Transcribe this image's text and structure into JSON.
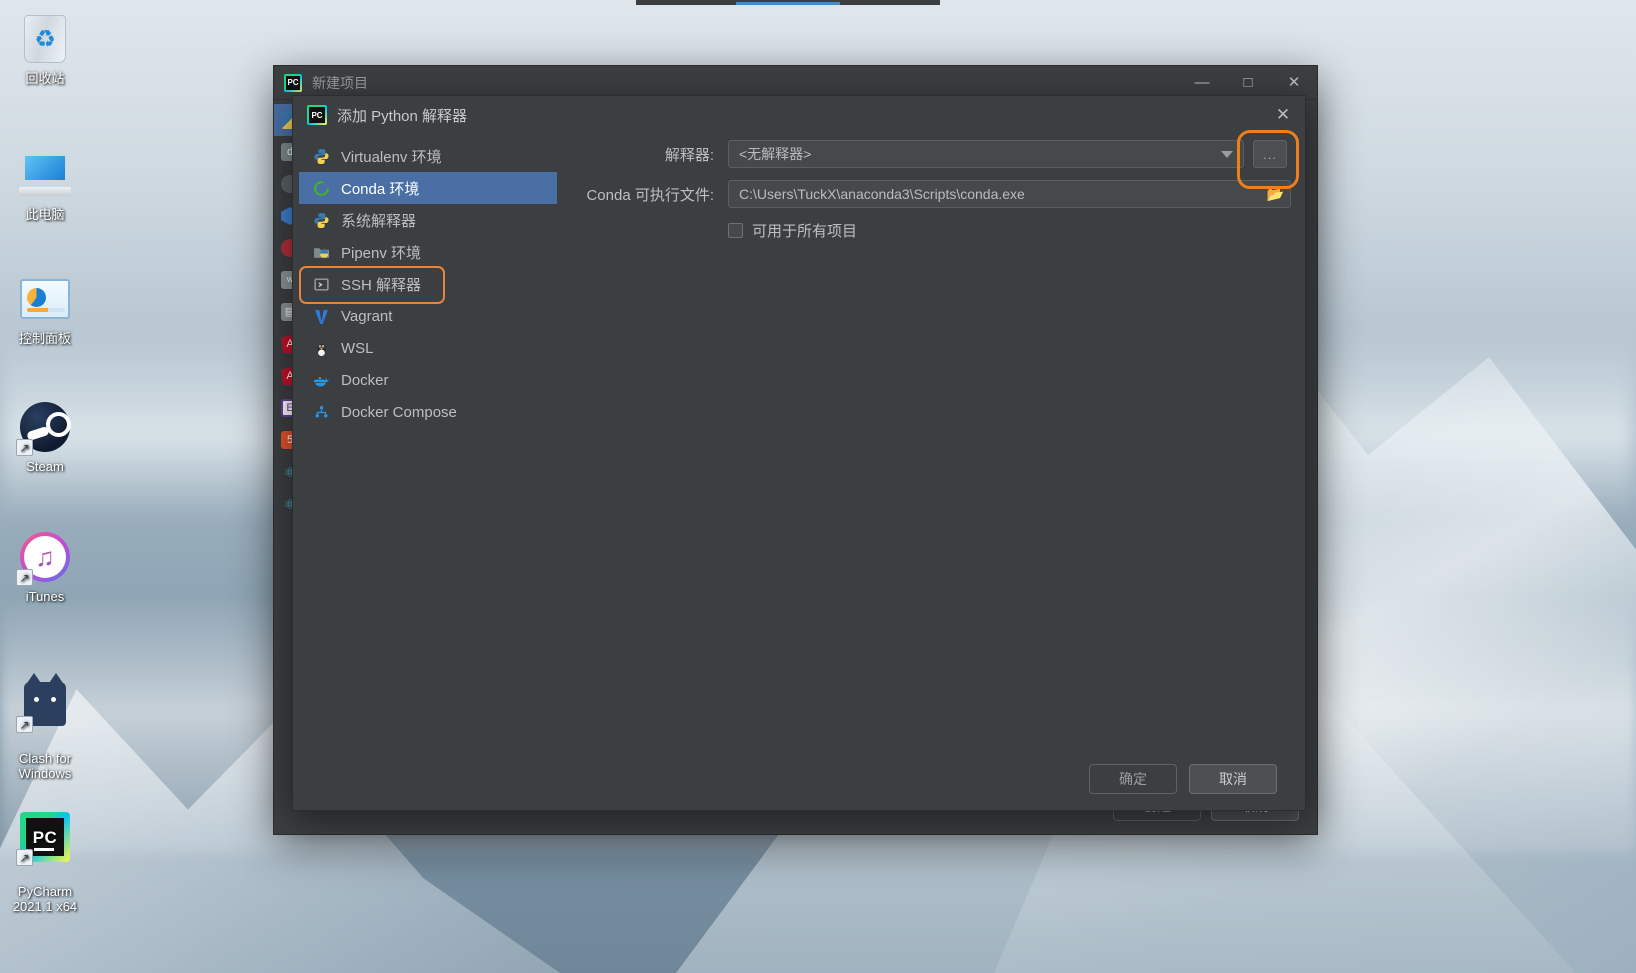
{
  "desktop": {
    "icons": [
      {
        "name": "recycle-bin",
        "label": "回收站"
      },
      {
        "name": "this-pc",
        "label": "此电脑"
      },
      {
        "name": "control-panel",
        "label": "控制面板"
      },
      {
        "name": "steam",
        "label": "Steam"
      },
      {
        "name": "itunes",
        "label": "iTunes"
      },
      {
        "name": "clash-for-windows",
        "label": "Clash for\nWindows"
      },
      {
        "name": "pycharm",
        "label": "PyCharm\n2021.1 x64"
      }
    ]
  },
  "new_project_window": {
    "title": "新建项目",
    "minimize": "—",
    "maximize": "□",
    "close": "✕",
    "footer": {
      "create": "创建",
      "cancel": "取消"
    }
  },
  "add_interpreter_dialog": {
    "title": "添加 Python 解释器",
    "close": "✕",
    "list": [
      {
        "label": "Virtualenv 环境",
        "icon": "virtualenv-icon",
        "selected": false
      },
      {
        "label": "Conda 环境",
        "icon": "conda-icon",
        "selected": true
      },
      {
        "label": "系统解释器",
        "icon": "python-icon",
        "selected": false
      },
      {
        "label": "Pipenv 环境",
        "icon": "pipenv-icon",
        "selected": false
      },
      {
        "label": "SSH 解释器",
        "icon": "ssh-icon",
        "selected": false
      },
      {
        "label": "Vagrant",
        "icon": "vagrant-icon",
        "selected": false
      },
      {
        "label": "WSL",
        "icon": "linux-icon",
        "selected": false
      },
      {
        "label": "Docker",
        "icon": "docker-icon",
        "selected": false
      },
      {
        "label": "Docker Compose",
        "icon": "docker-compose-icon",
        "selected": false
      }
    ],
    "form": {
      "interpreter_label": "解释器:",
      "interpreter_value": "<无解释器>",
      "browse_button": "...",
      "conda_exe_label": "Conda 可执行文件:",
      "conda_exe_value": "C:\\Users\\TuckX\\anaconda3\\Scripts\\conda.exe",
      "available_all_label": "可用于所有项目",
      "available_all_checked": false
    },
    "footer": {
      "ok": "确定",
      "cancel": "取消"
    }
  },
  "highlights": {
    "accent_color": "#ef7f1a",
    "selection_color": "#4a6fa5"
  }
}
